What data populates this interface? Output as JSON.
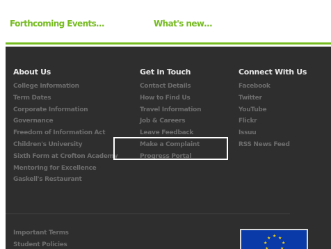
{
  "top_nav": {
    "forthcoming_label": "Forthcoming Events…",
    "whats_new_label": "What's new…"
  },
  "footer": {
    "about": {
      "title": "About Us",
      "links": [
        "College Information",
        "Term Dates",
        "Corporate Information",
        "Governance",
        "Freedom of Information Act",
        "Children's University",
        "Sixth Form at Crofton Academy",
        "Mentoring for Excellence",
        "Gaskell's Restaurant"
      ]
    },
    "contact": {
      "title": "Get in Touch",
      "links": [
        "Contact Details",
        "How to Find Us",
        "Travel Information",
        "Job & Careers",
        "Leave Feedback",
        "Make a Complaint",
        "Progress Portal"
      ]
    },
    "social": {
      "title": "Connect With Us",
      "links": [
        "Facebook",
        "Twitter",
        "YouTube",
        "Flickr",
        "Issuu",
        "RSS News Feed"
      ]
    },
    "legal_links": [
      "Important Terms",
      "Student Policies"
    ]
  },
  "colors": {
    "accent_green": "#76bc21",
    "footer_bg": "#2e2e2e",
    "eu_blue": "#0a3aa8",
    "eu_gold": "#ffd800",
    "highlight_border": "#ffffff"
  },
  "icons": {
    "eu_flag": "eu-flag-icon"
  }
}
